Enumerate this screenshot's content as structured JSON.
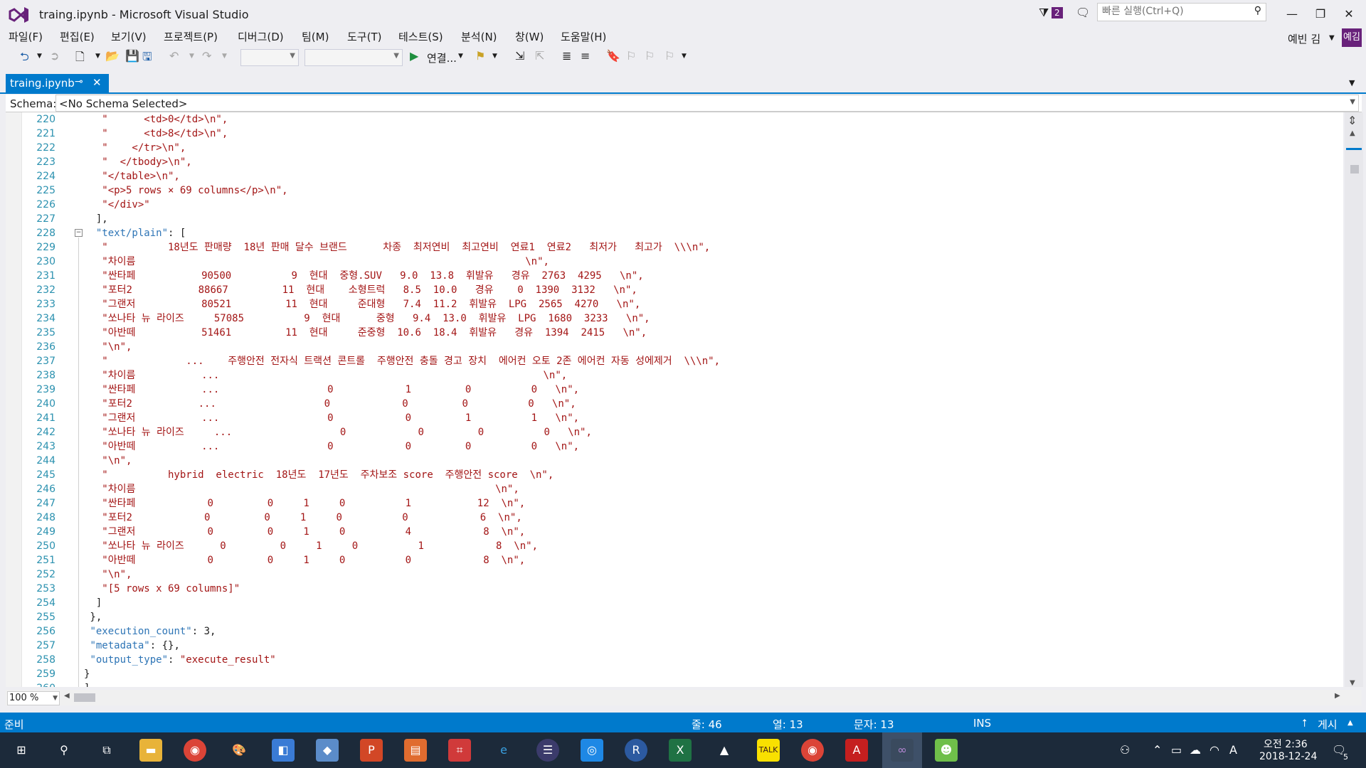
{
  "window": {
    "title": "traing.ipynb - Microsoft Visual Studio",
    "notification_count": "2",
    "quick_launch_placeholder": "빠른 실행(Ctrl+Q)",
    "user_name": "예빈 김",
    "user_initials": "예김"
  },
  "menu": [
    "파일(F)",
    "편집(E)",
    "보기(V)",
    "프로젝트(P)",
    "디버그(D)",
    "팀(M)",
    "도구(T)",
    "테스트(S)",
    "분석(N)",
    "창(W)",
    "도움말(H)"
  ],
  "toolbar": {
    "run_label": "연결..."
  },
  "tab": {
    "name": "traing.ipynb"
  },
  "schema": {
    "label": "Schema:",
    "value": "<No Schema Selected>"
  },
  "editor": {
    "lines": [
      {
        "n": "220",
        "t": "   \"      <td>0</td>\\n\","
      },
      {
        "n": "221",
        "t": "   \"      <td>8</td>\\n\","
      },
      {
        "n": "222",
        "t": "   \"    </tr>\\n\","
      },
      {
        "n": "223",
        "t": "   \"  </tbody>\\n\","
      },
      {
        "n": "224",
        "t": "   \"</table>\\n\","
      },
      {
        "n": "225",
        "t": "   \"<p>5 rows × 69 columns</p>\\n\","
      },
      {
        "n": "226",
        "t": "   \"</div>\""
      },
      {
        "n": "227",
        "t": "  ],"
      },
      {
        "n": "228",
        "t": "  \"text/plain\": ["
      },
      {
        "n": "229",
        "t": "   \"          18년도 판매량  18년 판매 달수 브랜드      차종  최저연비  최고연비  연료1  연료2   최저가   최고가  \\\\\\n\","
      },
      {
        "n": "230",
        "t": "   \"차이름                                                                 \\n\","
      },
      {
        "n": "231",
        "t": "   \"싼타페           90500          9  현대  중형.SUV   9.0  13.8  휘발유   경유  2763  4295   \\n\","
      },
      {
        "n": "232",
        "t": "   \"포터2           88667         11  현대    소형트럭   8.5  10.0   경유    0  1390  3132   \\n\","
      },
      {
        "n": "233",
        "t": "   \"그랜저           80521         11  현대     준대형   7.4  11.2  휘발유  LPG  2565  4270   \\n\","
      },
      {
        "n": "234",
        "t": "   \"쏘나타 뉴 라이즈     57085          9  현대      중형   9.4  13.0  휘발유  LPG  1680  3233   \\n\","
      },
      {
        "n": "235",
        "t": "   \"아반떼           51461         11  현대     준중형  10.6  18.4  휘발유   경유  1394  2415   \\n\","
      },
      {
        "n": "236",
        "t": "   \"\\n\","
      },
      {
        "n": "237",
        "t": "   \"             ...    주행안전 전자식 트랙션 콘트롤  주행안전 충돌 경고 장치  에어컨 오토 2존 에어컨 자동 성에제거  \\\\\\n\","
      },
      {
        "n": "238",
        "t": "   \"차이름           ...                                                      \\n\","
      },
      {
        "n": "239",
        "t": "   \"싼타페           ...                  0            1         0          0   \\n\","
      },
      {
        "n": "240",
        "t": "   \"포터2           ...                  0            0         0          0   \\n\","
      },
      {
        "n": "241",
        "t": "   \"그랜저           ...                  0            0         1          1   \\n\","
      },
      {
        "n": "242",
        "t": "   \"쏘나타 뉴 라이즈     ...                  0            0         0          0   \\n\","
      },
      {
        "n": "243",
        "t": "   \"아반떼           ...                  0            0         0          0   \\n\","
      },
      {
        "n": "244",
        "t": "   \"\\n\","
      },
      {
        "n": "245",
        "t": "   \"          hybrid  electric  18년도  17년도  주차보조 score  주행안전 score  \\n\","
      },
      {
        "n": "246",
        "t": "   \"차이름                                                            \\n\","
      },
      {
        "n": "247",
        "t": "   \"싼타페            0         0     1     0          1           12  \\n\","
      },
      {
        "n": "248",
        "t": "   \"포터2            0         0     1     0          0            6  \\n\","
      },
      {
        "n": "249",
        "t": "   \"그랜저            0         0     1     0          4            8  \\n\","
      },
      {
        "n": "250",
        "t": "   \"쏘나타 뉴 라이즈      0         0     1     0          1            8  \\n\","
      },
      {
        "n": "251",
        "t": "   \"아반떼            0         0     1     0          0            8  \\n\","
      },
      {
        "n": "252",
        "t": "   \"\\n\","
      },
      {
        "n": "253",
        "t": "   \"[5 rows x 69 columns]\""
      },
      {
        "n": "254",
        "t": "  ]"
      },
      {
        "n": "255",
        "t": " },"
      },
      {
        "n": "256",
        "t": " \"execution_count\": 3,"
      },
      {
        "n": "257",
        "t": " \"metadata\": {},"
      },
      {
        "n": "258",
        "t": " \"output_type\": \"execute_result\""
      },
      {
        "n": "259",
        "t": "}"
      },
      {
        "n": "260",
        "t": "]"
      }
    ]
  },
  "zoom": "100 %",
  "status": {
    "ready": "준비",
    "line": "줄: 46",
    "col": "열: 13",
    "char": "문자: 13",
    "mode": "INS",
    "publish": "게시"
  },
  "taskbar": {
    "time": "오전 2:36",
    "date": "2018-12-24",
    "notification_count": "5",
    "lang": "A"
  },
  "colors": {
    "accent": "#007acc",
    "vs_purple": "#68217a",
    "string": "#a31515",
    "key": "#2e75b6"
  }
}
